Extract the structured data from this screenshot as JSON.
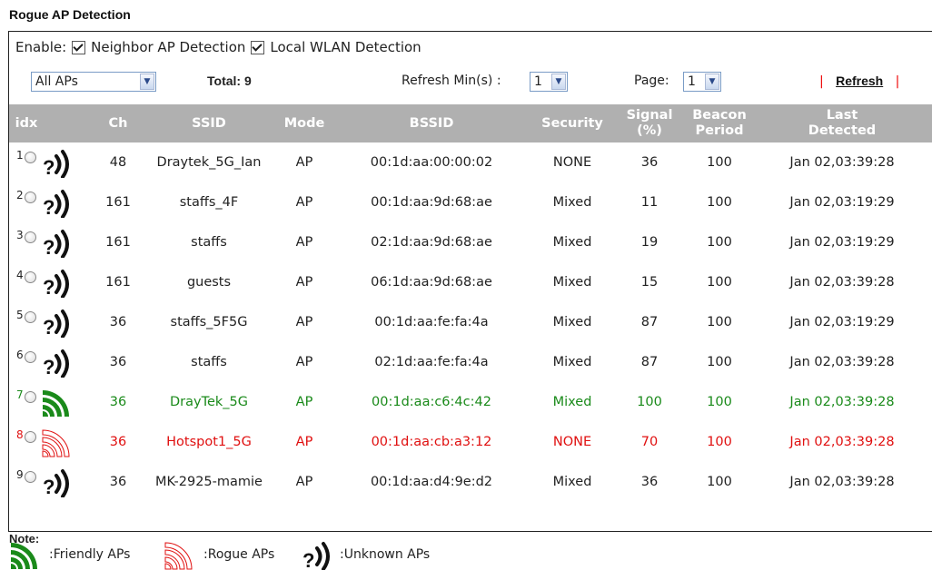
{
  "title": "Rogue AP Detection",
  "enable": {
    "label": "Enable:",
    "neighbor_label": "Neighbor AP Detection",
    "local_label": "Local WLAN Detection"
  },
  "controls": {
    "filter_value": "All APs",
    "total_label": "Total: 9",
    "refresh_min_label": "Refresh Min(s) :",
    "refresh_min_value": "1",
    "page_label": "Page:",
    "page_value": "1",
    "refresh_label": "Refresh",
    "bar": "|"
  },
  "table": {
    "headers": {
      "idx": "idx",
      "ch": "Ch",
      "ssid": "SSID",
      "mode": "Mode",
      "bssid": "BSSID",
      "security": "Security",
      "signal": "Signal (%)",
      "beacon": "Beacon Period",
      "last": "Last Detected"
    },
    "rows": [
      {
        "idx": "1",
        "type": "unknown",
        "ch": "48",
        "ssid": "Draytek_5G_Ian",
        "mode": "AP",
        "bssid": "00:1d:aa:00:00:02",
        "security": "NONE",
        "signal": "36",
        "beacon": "100",
        "last": "Jan 02,03:39:28"
      },
      {
        "idx": "2",
        "type": "unknown",
        "ch": "161",
        "ssid": "staffs_4F",
        "mode": "AP",
        "bssid": "00:1d:aa:9d:68:ae",
        "security": "Mixed",
        "signal": "11",
        "beacon": "100",
        "last": "Jan 02,03:19:29"
      },
      {
        "idx": "3",
        "type": "unknown",
        "ch": "161",
        "ssid": "staffs",
        "mode": "AP",
        "bssid": "02:1d:aa:9d:68:ae",
        "security": "Mixed",
        "signal": "19",
        "beacon": "100",
        "last": "Jan 02,03:19:29"
      },
      {
        "idx": "4",
        "type": "unknown",
        "ch": "161",
        "ssid": "guests",
        "mode": "AP",
        "bssid": "06:1d:aa:9d:68:ae",
        "security": "Mixed",
        "signal": "15",
        "beacon": "100",
        "last": "Jan 02,03:39:28"
      },
      {
        "idx": "5",
        "type": "unknown",
        "ch": "36",
        "ssid": "staffs_5F5G",
        "mode": "AP",
        "bssid": "00:1d:aa:fe:fa:4a",
        "security": "Mixed",
        "signal": "87",
        "beacon": "100",
        "last": "Jan 02,03:19:29"
      },
      {
        "idx": "6",
        "type": "unknown",
        "ch": "36",
        "ssid": "staffs",
        "mode": "AP",
        "bssid": "02:1d:aa:fe:fa:4a",
        "security": "Mixed",
        "signal": "87",
        "beacon": "100",
        "last": "Jan 02,03:39:28"
      },
      {
        "idx": "7",
        "type": "friendly",
        "ch": "36",
        "ssid": "DrayTek_5G",
        "mode": "AP",
        "bssid": "00:1d:aa:c6:4c:42",
        "security": "Mixed",
        "signal": "100",
        "beacon": "100",
        "last": "Jan 02,03:39:28"
      },
      {
        "idx": "8",
        "type": "rogue",
        "ch": "36",
        "ssid": "Hotspot1_5G",
        "mode": "AP",
        "bssid": "00:1d:aa:cb:a3:12",
        "security": "NONE",
        "signal": "70",
        "beacon": "100",
        "last": "Jan 02,03:39:28"
      },
      {
        "idx": "9",
        "type": "unknown",
        "ch": "36",
        "ssid": "MK-2925-mamie",
        "mode": "AP",
        "bssid": "00:1d:aa:d4:9e:d2",
        "security": "Mixed",
        "signal": "36",
        "beacon": "100",
        "last": "Jan 02,03:39:28"
      }
    ]
  },
  "note": {
    "label": "Note:",
    "friendly": ":Friendly APs",
    "rogue": ":Rogue APs",
    "unknown": ":Unknown APs"
  },
  "colors": {
    "friendly": "#1a8a1a",
    "rogue": "#e01010",
    "header_bg": "#b0b0b0"
  },
  "icons": {
    "friendly": "friendly-ap-icon",
    "rogue": "rogue-ap-icon",
    "unknown": "unknown-ap-icon"
  }
}
